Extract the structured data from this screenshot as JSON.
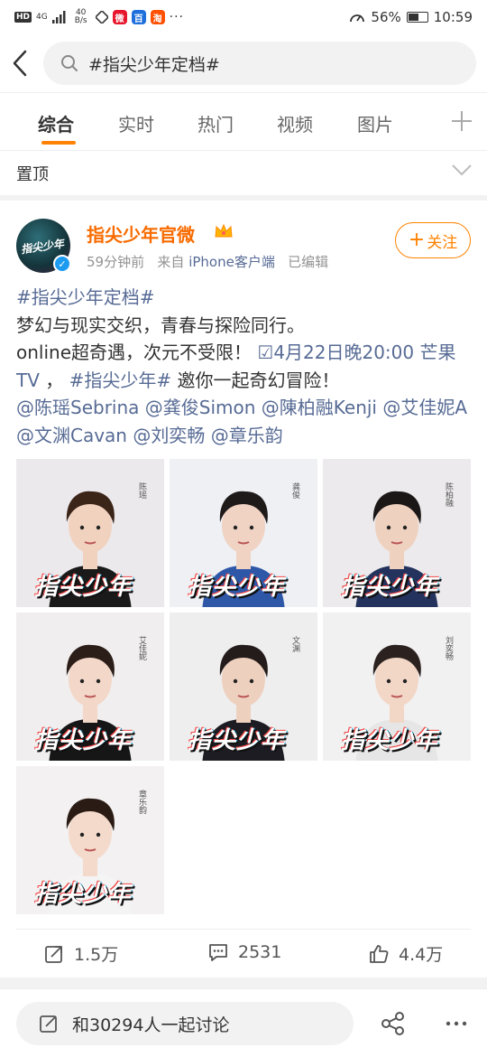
{
  "status_bar": {
    "hd": "HD",
    "signal": "4G",
    "speed_value": "40",
    "speed_unit": "B/s",
    "battery": "56%",
    "time": "10:59",
    "apps": [
      {
        "icon": "weibo-icon",
        "label": "微",
        "color": "#e6162d"
      },
      {
        "icon": "baidu-icon",
        "label": "百",
        "color": "#1e6fdc"
      },
      {
        "icon": "taobao-icon",
        "label": "淘",
        "color": "#ff5000"
      }
    ]
  },
  "search": {
    "value": "#指尖少年定档#"
  },
  "tabs": [
    {
      "label": "综合",
      "active": true
    },
    {
      "label": "实时",
      "active": false
    },
    {
      "label": "热门",
      "active": false
    },
    {
      "label": "视频",
      "active": false
    },
    {
      "label": "图片",
      "active": false
    }
  ],
  "pinned_label": "置顶",
  "post": {
    "avatar_text": "指尖少年",
    "username": "指尖少年官微",
    "time": "59分钟前",
    "from_prefix": "来自",
    "source": "iPhone客户端",
    "edited": "已编辑",
    "follow_label": "关注",
    "hashtag_title": "#指尖少年定档#",
    "line1": "梦幻与现实交织，青春与探险同行。",
    "line2_start": "online超奇遇，次元不受限！",
    "date_link": "4月22日晚20:00 芒果TV",
    "comma": "，",
    "hashtag2": "#指尖少年#",
    "invite": "邀你一起奇幻冒险！",
    "mentions": [
      "@陈瑶Sebrina",
      "@龚俊Simon",
      "@陳柏融Kenji",
      "@艾佳妮A",
      "@文渊Cavan",
      "@刘奕畅",
      "@章乐韵"
    ],
    "photos": [
      {
        "name": "陈瑶",
        "logo": "指尖少年",
        "skin": "#f1d2bf",
        "hair": "#3b2418",
        "cloth": "#1a1a1a",
        "bg": "#ece9ec"
      },
      {
        "name": "龚俊",
        "logo": "指尖少年",
        "skin": "#f0d3c3",
        "hair": "#1f1a1a",
        "cloth": "#2f57a8",
        "bg": "#eef0f4"
      },
      {
        "name": "陈柏融",
        "logo": "指尖少年",
        "skin": "#efd1bf",
        "hair": "#1b1716",
        "cloth": "#24335d",
        "bg": "#eceaec"
      },
      {
        "name": "艾佳妮",
        "logo": "指尖少年",
        "skin": "#f3d7c8",
        "hair": "#2b1d18",
        "cloth": "#161616",
        "bg": "#f0eeee"
      },
      {
        "name": "文渊",
        "logo": "指尖少年",
        "skin": "#eed0bf",
        "hair": "#241c1a",
        "cloth": "#1c1c22",
        "bg": "#efeeee"
      },
      {
        "name": "刘奕畅",
        "logo": "指尖少年",
        "skin": "#f2d6c6",
        "hair": "#2b2220",
        "cloth": "#e6e6e6",
        "bg": "#f2f1f1"
      },
      {
        "name": "章乐韵",
        "logo": "指尖少年",
        "skin": "#f4dacb",
        "hair": "#2a1c15",
        "cloth": "#f4f4f4",
        "bg": "#f3f1f1"
      }
    ]
  },
  "actions": {
    "repost": "1.5万",
    "comment": "2531",
    "like": "4.4万"
  },
  "bottom": {
    "discuss": "和30294人一起讨论"
  }
}
